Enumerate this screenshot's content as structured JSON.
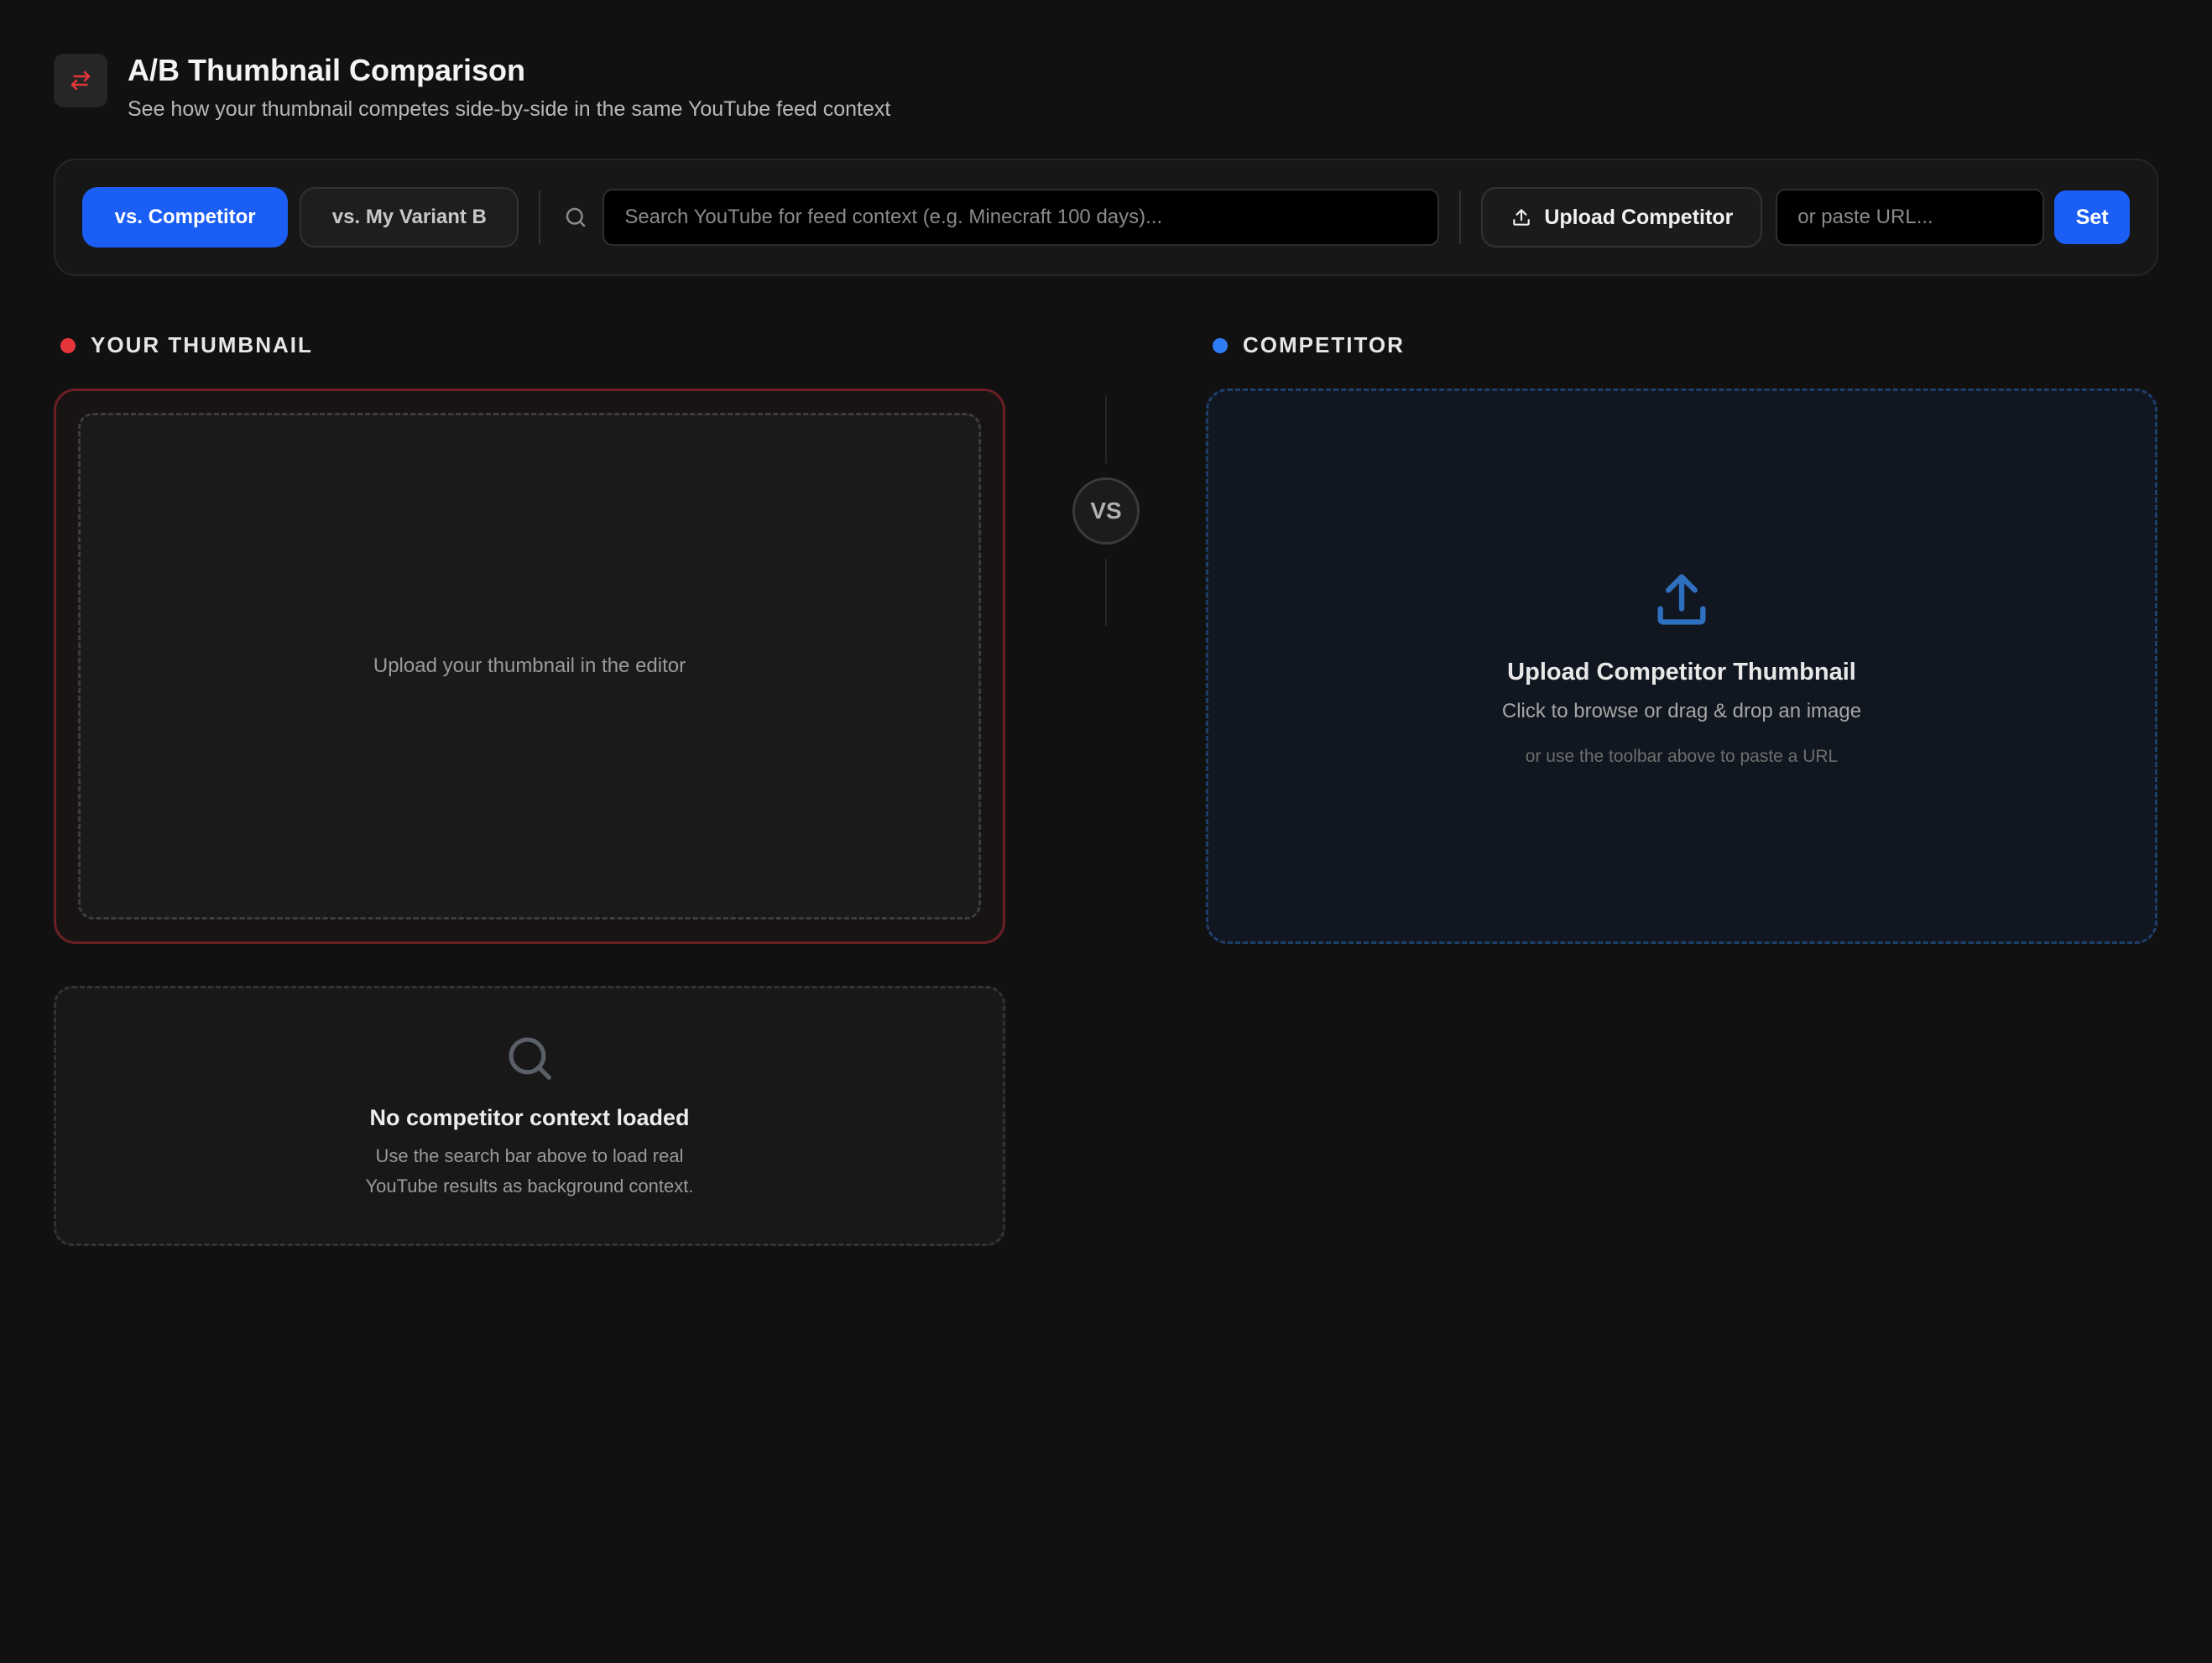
{
  "header": {
    "title": "A/B Thumbnail Comparison",
    "subtitle": "See how your thumbnail competes side-by-side in the same YouTube feed context",
    "icon": "swap-arrows-icon",
    "icon_color": "#e5353b"
  },
  "toolbar": {
    "mode_competitor": "vs. Competitor",
    "mode_variant": "vs. My Variant B",
    "active_mode": "vs. Competitor",
    "search_placeholder": "Search YouTube for feed context (e.g. Minecraft 100 days)...",
    "upload_label": "Upload Competitor",
    "url_placeholder": "or paste URL...",
    "set_label": "Set"
  },
  "your_thumbnail": {
    "label": "YOUR THUMBNAIL",
    "dot_color": "#e5353b",
    "placeholder": "Upload your thumbnail in the editor"
  },
  "vs_label": "VS",
  "competitor": {
    "label": "COMPETITOR",
    "dot_color": "#2f7cf6",
    "title": "Upload Competitor Thumbnail",
    "subtitle": "Click to browse or drag & drop an image",
    "hint": "or use the toolbar above to paste a URL"
  },
  "context": {
    "title": "No competitor context loaded",
    "line1": "Use the search bar above to load real",
    "line2": "YouTube results as background context."
  },
  "colors": {
    "accent": "#1b5ef5",
    "background": "#111111"
  }
}
